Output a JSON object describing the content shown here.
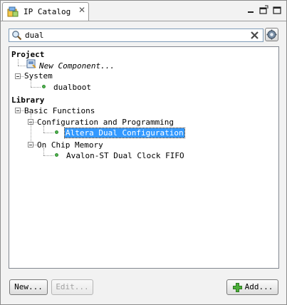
{
  "tab": {
    "title": "IP Catalog",
    "close_glyph": "✕"
  },
  "search": {
    "value": "dual",
    "placeholder": ""
  },
  "tree": {
    "project_label": "Project",
    "new_component": "New Component...",
    "system_label": "System",
    "system_child": "dualboot",
    "library_label": "Library",
    "basic_functions": "Basic Functions",
    "config_programming": "Configuration and Programming",
    "altera_dual_config": "Altera Dual Configuration",
    "on_chip_memory": "On Chip Memory",
    "avalon_fifo": "Avalon-ST Dual Clock FIFO"
  },
  "buttons": {
    "new": "New...",
    "edit": "Edit...",
    "add": "Add..."
  },
  "colors": {
    "selection": "#3399ff",
    "status_dot": "#52b452"
  }
}
